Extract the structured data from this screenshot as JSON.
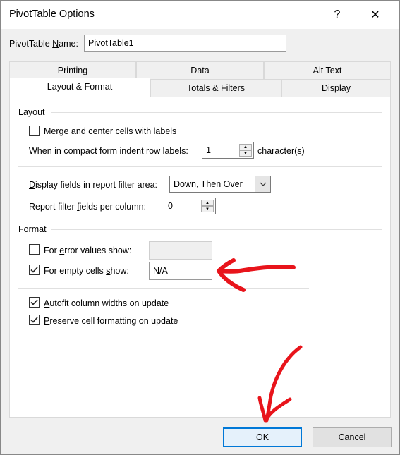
{
  "window": {
    "title": "PivotTable Options",
    "help_glyph": "?",
    "close_glyph": "✕"
  },
  "name_field": {
    "label_prefix": "PivotTable ",
    "label_accel": "N",
    "label_suffix": "ame:",
    "value": "PivotTable1"
  },
  "tabs": {
    "printing": "Printing",
    "data": "Data",
    "alt_text": "Alt Text",
    "layout_format": "Layout & Format",
    "totals_filters": "Totals & Filters",
    "display": "Display"
  },
  "layout": {
    "section_title": "Layout",
    "merge": {
      "accel": "M",
      "rest": "erge and center cells with labels",
      "checked": false
    },
    "indent": {
      "label": "When in compact form indent row labels:",
      "value": "1",
      "unit": "character(s)"
    },
    "display_fields": {
      "accel": "D",
      "rest": "isplay fields in report filter area:",
      "value": "Down, Then Over"
    },
    "filter_fields": {
      "pre": "Report filter ",
      "accel": "f",
      "rest": "ields per column:",
      "value": "0"
    }
  },
  "format": {
    "section_title": "Format",
    "error_values": {
      "pre": "For ",
      "accel": "e",
      "rest": "rror values show:",
      "checked": false,
      "value": ""
    },
    "empty_cells": {
      "pre": "For empty cells ",
      "accel": "s",
      "rest": "how:",
      "checked": true,
      "value": "N/A"
    },
    "autofit": {
      "accel": "A",
      "rest": "utofit column widths on update",
      "checked": true
    },
    "preserve": {
      "accel": "P",
      "rest": "reserve cell formatting on update",
      "checked": true
    }
  },
  "buttons": {
    "ok": "OK",
    "cancel": "Cancel"
  },
  "colors": {
    "annotation": "#e8141b",
    "focus": "#0078d7"
  }
}
